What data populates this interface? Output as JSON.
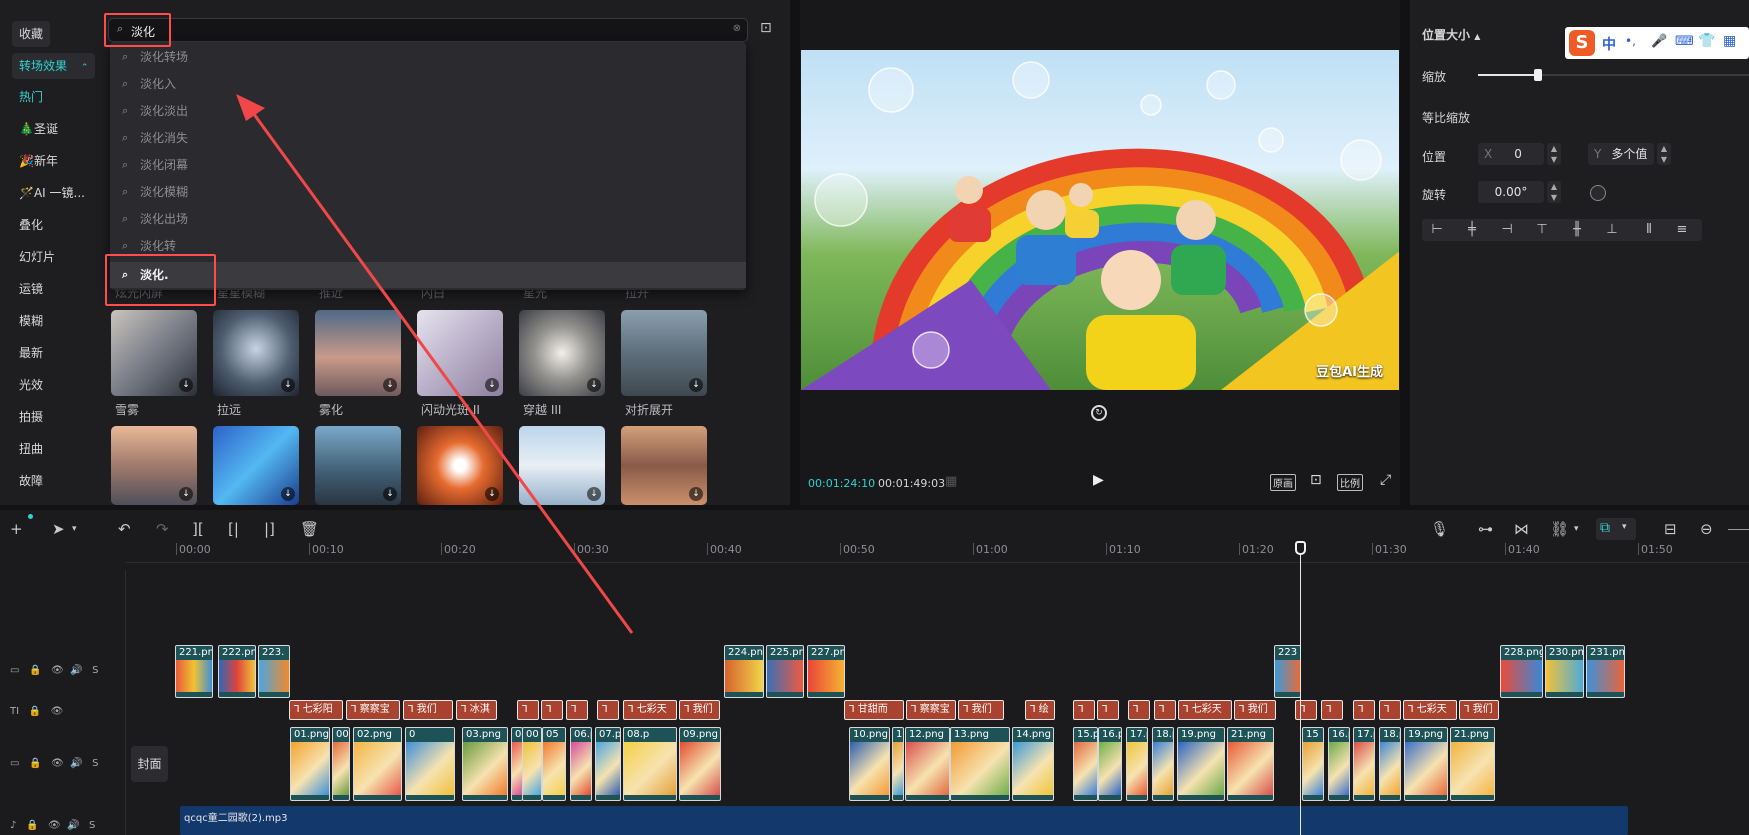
{
  "categories": {
    "favorites": "收藏",
    "transitions": "转场效果",
    "hot": "热门",
    "christmas": "🎄圣诞",
    "new_year": "🎉新年",
    "ai": "🪄AI 一镜...",
    "overlay": "叠化",
    "slideshow": "幻灯片",
    "camera": "运镜",
    "blur": "模糊",
    "latest": "最新",
    "light": "光效",
    "shoot": "拍摄",
    "distort": "扭曲",
    "glitch": "故障"
  },
  "search": {
    "value": "淡化",
    "suggestions": [
      "淡化转场",
      "淡化入",
      "淡化淡出",
      "淡化消失",
      "淡化闭幕",
      "淡化模糊",
      "淡化出场",
      "淡化转"
    ],
    "active_suggestion": "淡化."
  },
  "effects_row_hidden_labels": [
    "炫光闪屏",
    "星星模糊",
    "推近",
    "闪白",
    "星光",
    "拉开"
  ],
  "effects_row1": [
    "雪雾",
    "拉远",
    "雾化",
    "闪动光斑 II",
    "穿越 III",
    "对折展开"
  ],
  "preview": {
    "watermark": "豆包AI生成",
    "current_time": "00:01:24:10",
    "total_time": "00:01:49:03",
    "btn_original": "原画",
    "btn_ratio": "比例"
  },
  "properties": {
    "section_title": "位置大小",
    "scale_label": "缩放",
    "uniform_scale_label": "等比缩放",
    "position_label": "位置",
    "x_label": "X",
    "x_value": "0",
    "y_label": "Y",
    "y_value": "多个值",
    "rotation_label": "旋转",
    "rotation_value": "0.00°",
    "scale_fraction": 0.22
  },
  "ime_toolbar": {
    "lang": "中",
    "punct": "•,"
  },
  "timeline": {
    "ruler": [
      "00:00",
      "00:10",
      "00:20",
      "00:30",
      "00:40",
      "00:50",
      "01:00",
      "01:10",
      "01:20",
      "01:30",
      "01:40",
      "01:50"
    ],
    "cover_label": "封面",
    "audio_clip": "qcqc童二园歌(2).mp3",
    "overlay_clips": [
      "221.png",
      "222.png",
      "223.",
      "224.png",
      "225.png",
      "227.png",
      "223",
      "228.png",
      "230.png",
      "231.png"
    ],
    "text_clips": [
      "七彩阳",
      "察察宝",
      "我们",
      "冰淇",
      "七彩天",
      "我们",
      "甘甜而",
      "察察宝",
      "我们",
      "绘",
      "七彩天",
      "我们",
      "七彩天",
      "我们"
    ],
    "main_clips": [
      "01.png",
      "00",
      "02.png",
      "0",
      "03.png",
      "04.png",
      "00",
      "05",
      "06.p",
      "07.p",
      "08.p",
      "09.png",
      "10.png",
      "11.png",
      "12.png",
      "13.png",
      "14.png",
      "15.p",
      "16.p",
      "17.p",
      "18.p",
      "19.png",
      "21.png",
      "15",
      "16.p",
      "17.p",
      "18.p",
      "19.png",
      "21.png"
    ]
  },
  "track_ctrl": {
    "s": "S",
    "tt": "TI"
  }
}
